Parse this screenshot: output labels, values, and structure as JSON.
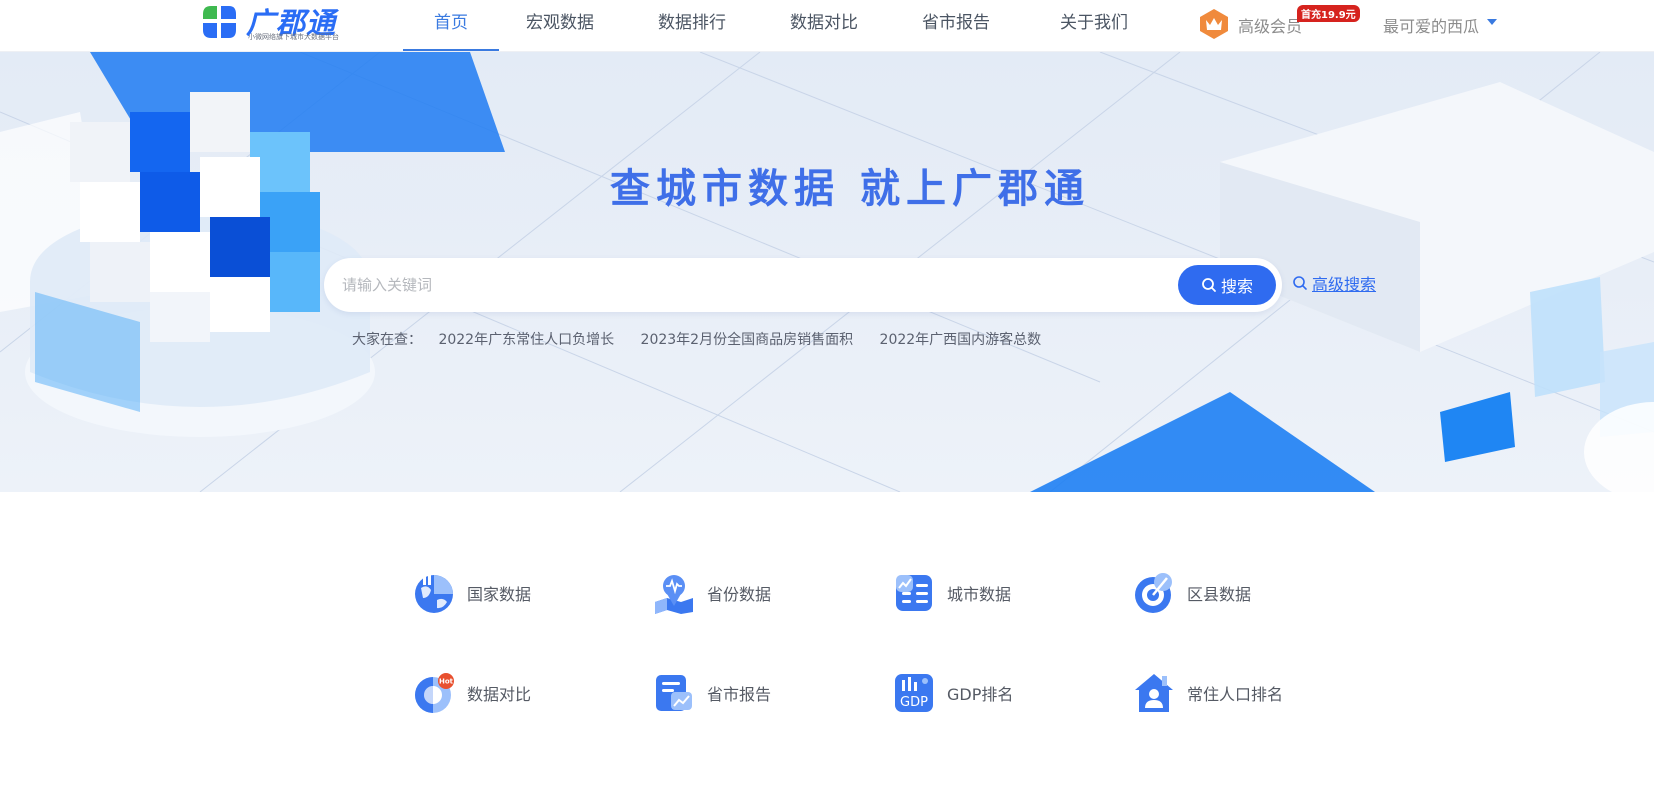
{
  "header": {
    "logo_text": "广郡通",
    "logo_tagline": "小微网络旗下城市大数据平台",
    "nav": [
      {
        "label": "首页",
        "active": true
      },
      {
        "label": "宏观数据",
        "active": false
      },
      {
        "label": "数据排行",
        "active": false
      },
      {
        "label": "数据对比",
        "active": false
      },
      {
        "label": "省市报告",
        "active": false
      },
      {
        "label": "关于我们",
        "active": false
      }
    ],
    "vip_label": "高级会员",
    "vip_badge": "首充19.9元",
    "user_name": "最可爱的西瓜"
  },
  "banner": {
    "headline": "查城市数据 就上广郡通",
    "search_placeholder": "请输入关键词",
    "search_button": "搜索",
    "advanced_search": "高级搜索",
    "hot_prefix": "大家在查：",
    "hot_queries": [
      "2022年广东常住人口负增长",
      "2023年2月份全国商品房销售面积",
      "2022年广西国内游客总数"
    ]
  },
  "categories": [
    {
      "label": "国家数据",
      "icon": "globe-chart-icon"
    },
    {
      "label": "省份数据",
      "icon": "province-map-icon"
    },
    {
      "label": "城市数据",
      "icon": "city-list-icon"
    },
    {
      "label": "区县数据",
      "icon": "target-icon"
    },
    {
      "label": "数据对比",
      "icon": "compare-pie-icon",
      "badge": "Hot"
    },
    {
      "label": "省市报告",
      "icon": "report-icon"
    },
    {
      "label": "GDP排名",
      "icon": "gdp-icon",
      "icon_text": "GDP"
    },
    {
      "label": "常住人口排名",
      "icon": "population-house-icon"
    }
  ],
  "colors": {
    "brand": "#2f6bf0",
    "nav_active": "#3a7ae0",
    "vip_badge": "#d6231e",
    "vip_crown": "#f08a3c"
  }
}
